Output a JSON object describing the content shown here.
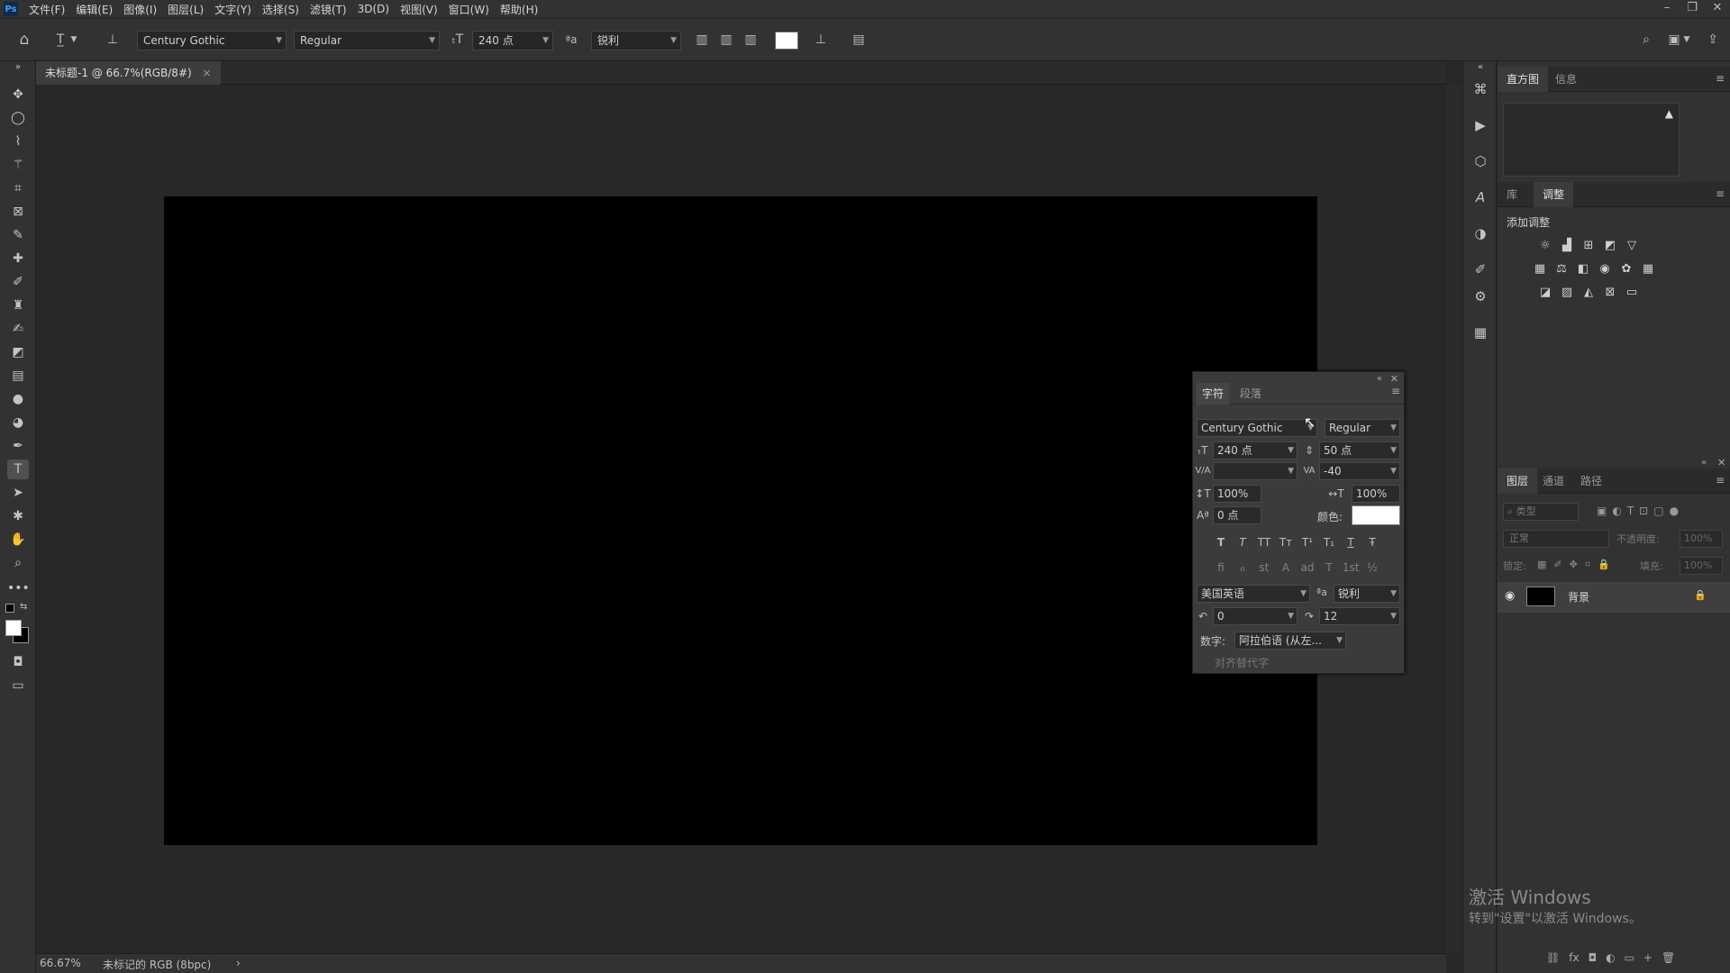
{
  "menubar": {
    "logo": "Ps",
    "items": [
      "文件(F)",
      "编辑(E)",
      "图像(I)",
      "图层(L)",
      "文字(Y)",
      "选择(S)",
      "滤镜(T)",
      "3D(D)",
      "视图(V)",
      "窗口(W)",
      "帮助(H)"
    ],
    "window_controls": [
      "–",
      "❐",
      "✕"
    ]
  },
  "options": {
    "font_family": "Century Gothic",
    "font_style": "Regular",
    "font_size": "240 点",
    "antialias_icon_text": "ªa",
    "antialias": "锐利"
  },
  "document": {
    "tab_title": "未标题-1 @ 66.7%(RGB/8#)",
    "tab_close": "×",
    "canvas_color": "#000000"
  },
  "statusbar": {
    "zoom": "66.67%",
    "profile": "未标记的 RGB (8bpc)",
    "arrow": "›"
  },
  "histogram_panel": {
    "tabs": [
      "直方图",
      "信息"
    ],
    "warning": "▲"
  },
  "adjust_panel": {
    "tabs": [
      "库",
      "调整"
    ],
    "title": "添加调整"
  },
  "layers_panel": {
    "tabs": [
      "图层",
      "通道",
      "路径"
    ],
    "search_placeholder": "类型",
    "blend_mode": "正常",
    "opacity_label": "不透明度:",
    "opacity_value": "100%",
    "lock_label": "锁定:",
    "fill_label": "填充:",
    "fill_value": "100%",
    "layer_name": "背景",
    "footer_icons": [
      "⛓",
      "fx",
      "◘",
      "◐",
      "▭",
      "+",
      "🗑"
    ]
  },
  "char_panel": {
    "tabs": [
      "字符",
      "段落"
    ],
    "font_family": "Century Gothic",
    "font_style": "Regular",
    "font_size": "240 点",
    "leading": "50 点",
    "kerning": "",
    "tracking": "-40",
    "vscale": "100%",
    "hscale": "100%",
    "baseline": "0 点",
    "color_label": "颜色:",
    "color_value": "#ffffff",
    "style_buttons": [
      "T",
      "T",
      "TT",
      "Tт",
      "T¹",
      "T₁",
      "T",
      "Ŧ"
    ],
    "opentype_buttons": [
      "ﬁ",
      "ℴ",
      "st",
      "A",
      "ad",
      "T",
      "1st",
      "½"
    ],
    "language": "美国英语",
    "aa_icon": "ªa",
    "antialias": "锐利",
    "hyph1": "0",
    "hyph2": "12",
    "digits_label": "数字:",
    "digits_value": "阿拉伯语 (从左...",
    "alt_glyphs": "对齐替代字"
  },
  "watermark": {
    "line1": "激活 Windows",
    "line2": "转到\"设置\"以激活 Windows。"
  },
  "colors": {
    "bg_dark": "#282828",
    "panel": "#323232",
    "accent_blue": "#31a8ff"
  }
}
